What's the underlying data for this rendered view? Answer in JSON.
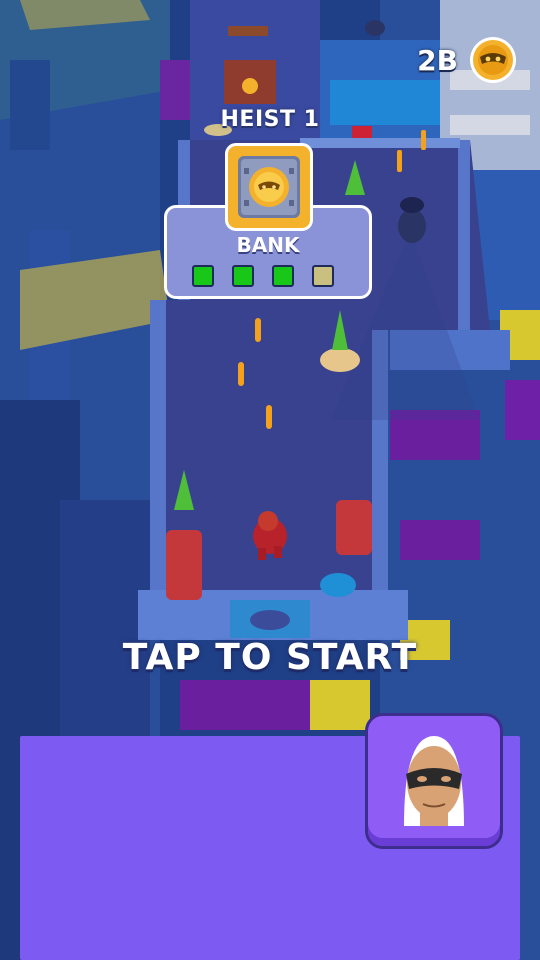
{
  "hud": {
    "coins": "2B",
    "coin_icon": "thief-mask-coin-icon"
  },
  "heist": {
    "title": "HEIST 1",
    "location": "BANK",
    "vault_icon": "vault-icon",
    "stages": [
      {
        "complete": true
      },
      {
        "complete": true
      },
      {
        "complete": true
      },
      {
        "complete": false
      }
    ]
  },
  "prompt": {
    "text": "TAP TO START"
  },
  "character_button": {
    "icon": "masked-thief-avatar-icon"
  },
  "colors": {
    "panel_purple": "#7d5af1",
    "stage_done": "#19c719",
    "stage_todo": "#c9c07f",
    "coin_gold": "#f4b12b"
  }
}
